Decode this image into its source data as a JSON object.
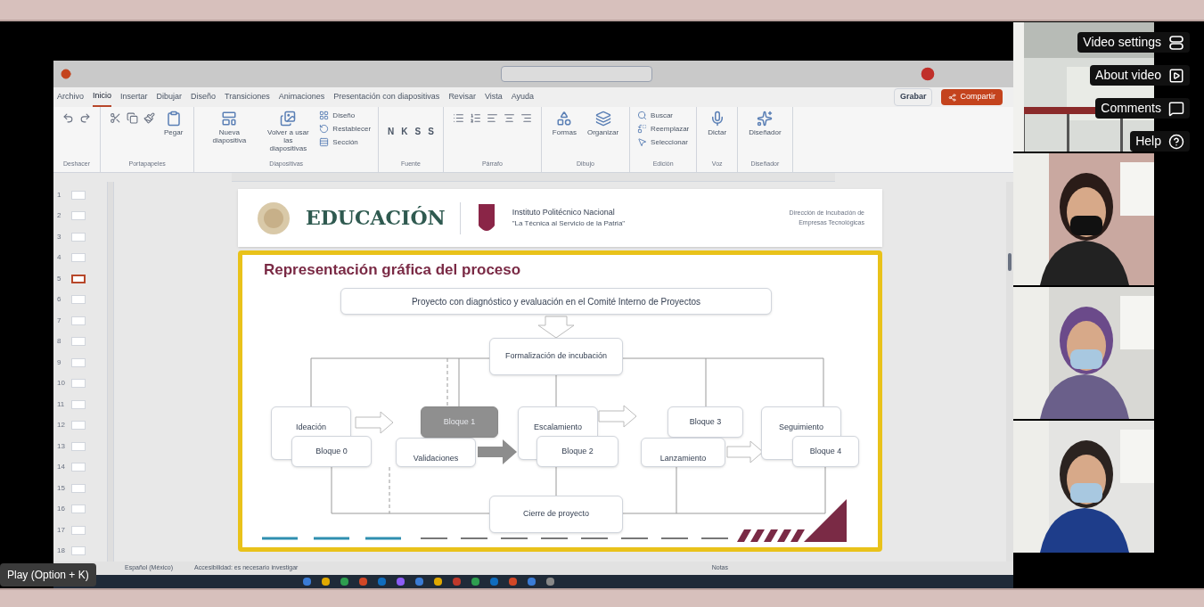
{
  "video_menu": [
    {
      "label": "Video settings",
      "kind": "settings"
    },
    {
      "label": "About video",
      "kind": "about"
    },
    {
      "label": "Comments",
      "kind": "comments"
    },
    {
      "label": "Help",
      "kind": "help"
    }
  ],
  "tooltip": "Play (Option + K)",
  "powerpoint": {
    "tabs": [
      {
        "label": "Archivo",
        "selected": false
      },
      {
        "label": "Inicio",
        "selected": true
      },
      {
        "label": "Insertar",
        "selected": false
      },
      {
        "label": "Dibujar",
        "selected": false
      },
      {
        "label": "Diseño",
        "selected": false
      },
      {
        "label": "Transiciones",
        "selected": false
      },
      {
        "label": "Animaciones",
        "selected": false
      },
      {
        "label": "Presentación con diapositivas",
        "selected": false
      },
      {
        "label": "Revisar",
        "selected": false
      },
      {
        "label": "Vista",
        "selected": false
      },
      {
        "label": "Ayuda",
        "selected": false
      }
    ],
    "record_button": "Grabar",
    "share_button": "Compartir",
    "ribbon_groups": [
      {
        "label": "Deshacer"
      },
      {
        "label": "Portapapeles",
        "buttons": [
          "Pegar"
        ]
      },
      {
        "label": "Diapositivas",
        "buttons": [
          "Nueva diapositiva",
          "Volver a usar las diapositivas",
          "Diseño",
          "Restablecer",
          "Sección"
        ]
      },
      {
        "label": "Fuente",
        "buttons": [
          "N",
          "K",
          "S",
          "S"
        ]
      },
      {
        "label": "Párrafo"
      },
      {
        "label": "Dibujo",
        "buttons": [
          "Formas",
          "Organizar"
        ]
      },
      {
        "label": "Edición",
        "buttons": [
          "Buscar",
          "Reemplazar",
          "Seleccionar"
        ]
      },
      {
        "label": "Voz",
        "buttons": [
          "Dictar"
        ]
      },
      {
        "label": "Diseñador",
        "buttons": [
          "Diseñador"
        ]
      }
    ],
    "thumbnails": [
      {
        "number": "1",
        "selected": false
      },
      {
        "number": "2",
        "selected": false
      },
      {
        "number": "3",
        "selected": false
      },
      {
        "number": "4",
        "selected": false
      },
      {
        "number": "5",
        "selected": true
      },
      {
        "number": "6",
        "selected": false
      },
      {
        "number": "7",
        "selected": false
      },
      {
        "number": "8",
        "selected": false
      },
      {
        "number": "9",
        "selected": false
      },
      {
        "number": "10",
        "selected": false
      },
      {
        "number": "11",
        "selected": false
      },
      {
        "number": "12",
        "selected": false
      },
      {
        "number": "13",
        "selected": false
      },
      {
        "number": "14",
        "selected": false
      },
      {
        "number": "15",
        "selected": false
      },
      {
        "number": "16",
        "selected": false
      },
      {
        "number": "17",
        "selected": false
      },
      {
        "number": "18",
        "selected": false
      }
    ],
    "slide": {
      "brand": "EDUCACIÓN",
      "institute": "Instituto Politécnico Nacional",
      "motto": "\"La Técnica al Servicio de la Patria\"",
      "department": "Dirección de Incubación de Empresas Tecnológicas",
      "title": "Representación gráfica del proceso",
      "nodes": [
        {
          "label": "Proyecto con diagnóstico y evaluación en el Comité Interno de Proyectos",
          "kind": "header"
        },
        {
          "label": "Formalización de incubación",
          "kind": "box"
        },
        {
          "label": "Ideación",
          "kind": "back"
        },
        {
          "label": "Bloque 0",
          "kind": "box"
        },
        {
          "label": "Validaciones",
          "kind": "back"
        },
        {
          "label": "Bloque 1",
          "kind": "highlight"
        },
        {
          "label": "Escalamiento",
          "kind": "back"
        },
        {
          "label": "Bloque 2",
          "kind": "box"
        },
        {
          "label": "Bloque 3",
          "kind": "box"
        },
        {
          "label": "Lanzamiento",
          "kind": "back"
        },
        {
          "label": "Seguimiento",
          "kind": "back"
        },
        {
          "label": "Bloque 4",
          "kind": "box"
        },
        {
          "label": "Cierre de proyecto",
          "kind": "box"
        }
      ]
    },
    "status_bar": [
      "Español (México)",
      "Accesibilidad: es necesario investigar",
      "Notas"
    ]
  }
}
